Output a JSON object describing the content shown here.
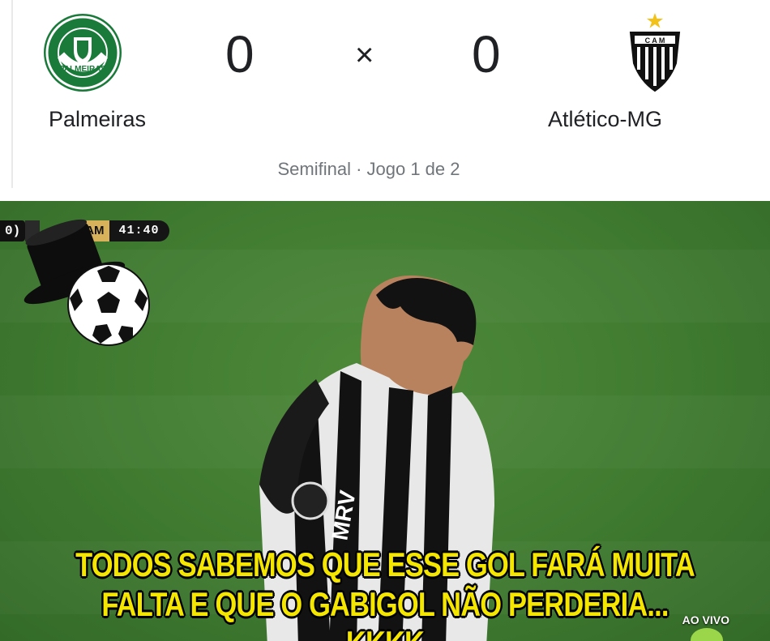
{
  "scoreboard": {
    "home_team": "Palmeiras",
    "away_team": "Atlético-MG",
    "home_score": "0",
    "away_score": "0",
    "separator": "×",
    "subtitle": "Semifinal · Jogo 1 de 2",
    "home_logo_text": "PALMEIRAS",
    "away_logo_text": "C A M"
  },
  "broadcast": {
    "scorebug_left": "0)",
    "scorebug_team": "AM",
    "clock": "41:40",
    "live_label": "AO VIVO",
    "shirt_sponsor": "MRV"
  },
  "meme": {
    "caption_line1": "TODOS SABEMOS QUE ESSE GOL FARÁ MUITA",
    "caption_line2": "FALTA E QUE O GABIGOL NÃO PERDERIA... KKKK"
  },
  "colors": {
    "palmeiras_green": "#1a7a3a",
    "caption_yellow": "#f4e600",
    "pitch_green": "#3f7a30",
    "atletico_star": "#f2c21a"
  }
}
